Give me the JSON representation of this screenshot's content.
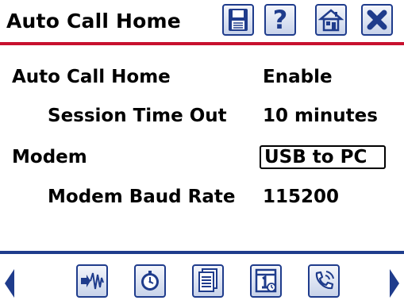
{
  "header": {
    "title": "Auto Call Home",
    "icons": [
      "save-icon",
      "help-icon",
      "home-icon",
      "close-icon"
    ],
    "help_glyph": "?"
  },
  "settings": [
    {
      "label": "Auto Call Home",
      "value": "Enable"
    },
    {
      "label": "Session Time Out",
      "value": "10 minutes"
    },
    {
      "label": "Modem",
      "value": "USB to PC"
    },
    {
      "label": "Modem Baud Rate",
      "value": "115200"
    }
  ],
  "footer": {
    "icons": [
      "waveform-icon",
      "clock-icon",
      "documents-icon",
      "calendar-icon",
      "phone-icon"
    ]
  },
  "colors": {
    "header_rule": "#c8102e",
    "footer_rule": "#1f3c8c",
    "icon_border": "#1f3c8c"
  }
}
